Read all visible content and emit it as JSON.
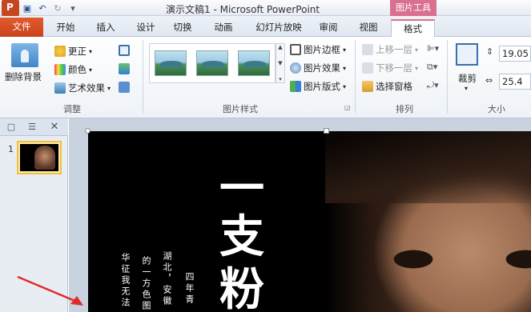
{
  "window": {
    "title": "演示文稿1 - Microsoft PowerPoint",
    "context_tool": "图片工具"
  },
  "tabs": [
    "文件",
    "开始",
    "插入",
    "设计",
    "切换",
    "动画",
    "幻灯片放映",
    "审阅",
    "视图",
    "格式"
  ],
  "ribbon": {
    "adjust": {
      "remove_background": "删除背景",
      "corrections": "更正",
      "color": "颜色",
      "artistic_effects": "艺术效果",
      "label": "调整"
    },
    "picture_styles": {
      "picture_border": "图片边框",
      "picture_effects": "图片效果",
      "picture_layout": "图片版式",
      "label": "图片样式"
    },
    "arrange": {
      "bring_forward": "上移一层",
      "send_backward": "下移一层",
      "selection_pane": "选择窗格",
      "label": "排列"
    },
    "size": {
      "crop": "裁剪",
      "height": "19.05",
      "width": "25.4",
      "label": "大小"
    }
  },
  "slides_pane": {
    "slide_number": "1"
  },
  "slide": {
    "title_chars": [
      "一",
      "支",
      "粉"
    ],
    "vertical_lines": [
      "华征我无法",
      "的一方色图",
      "湖北，安徽",
      "四年青"
    ]
  },
  "colors": {
    "file_tab": "#d24726",
    "context_tab": "#d9708f",
    "annotation_arrow": "#e02b2b"
  }
}
